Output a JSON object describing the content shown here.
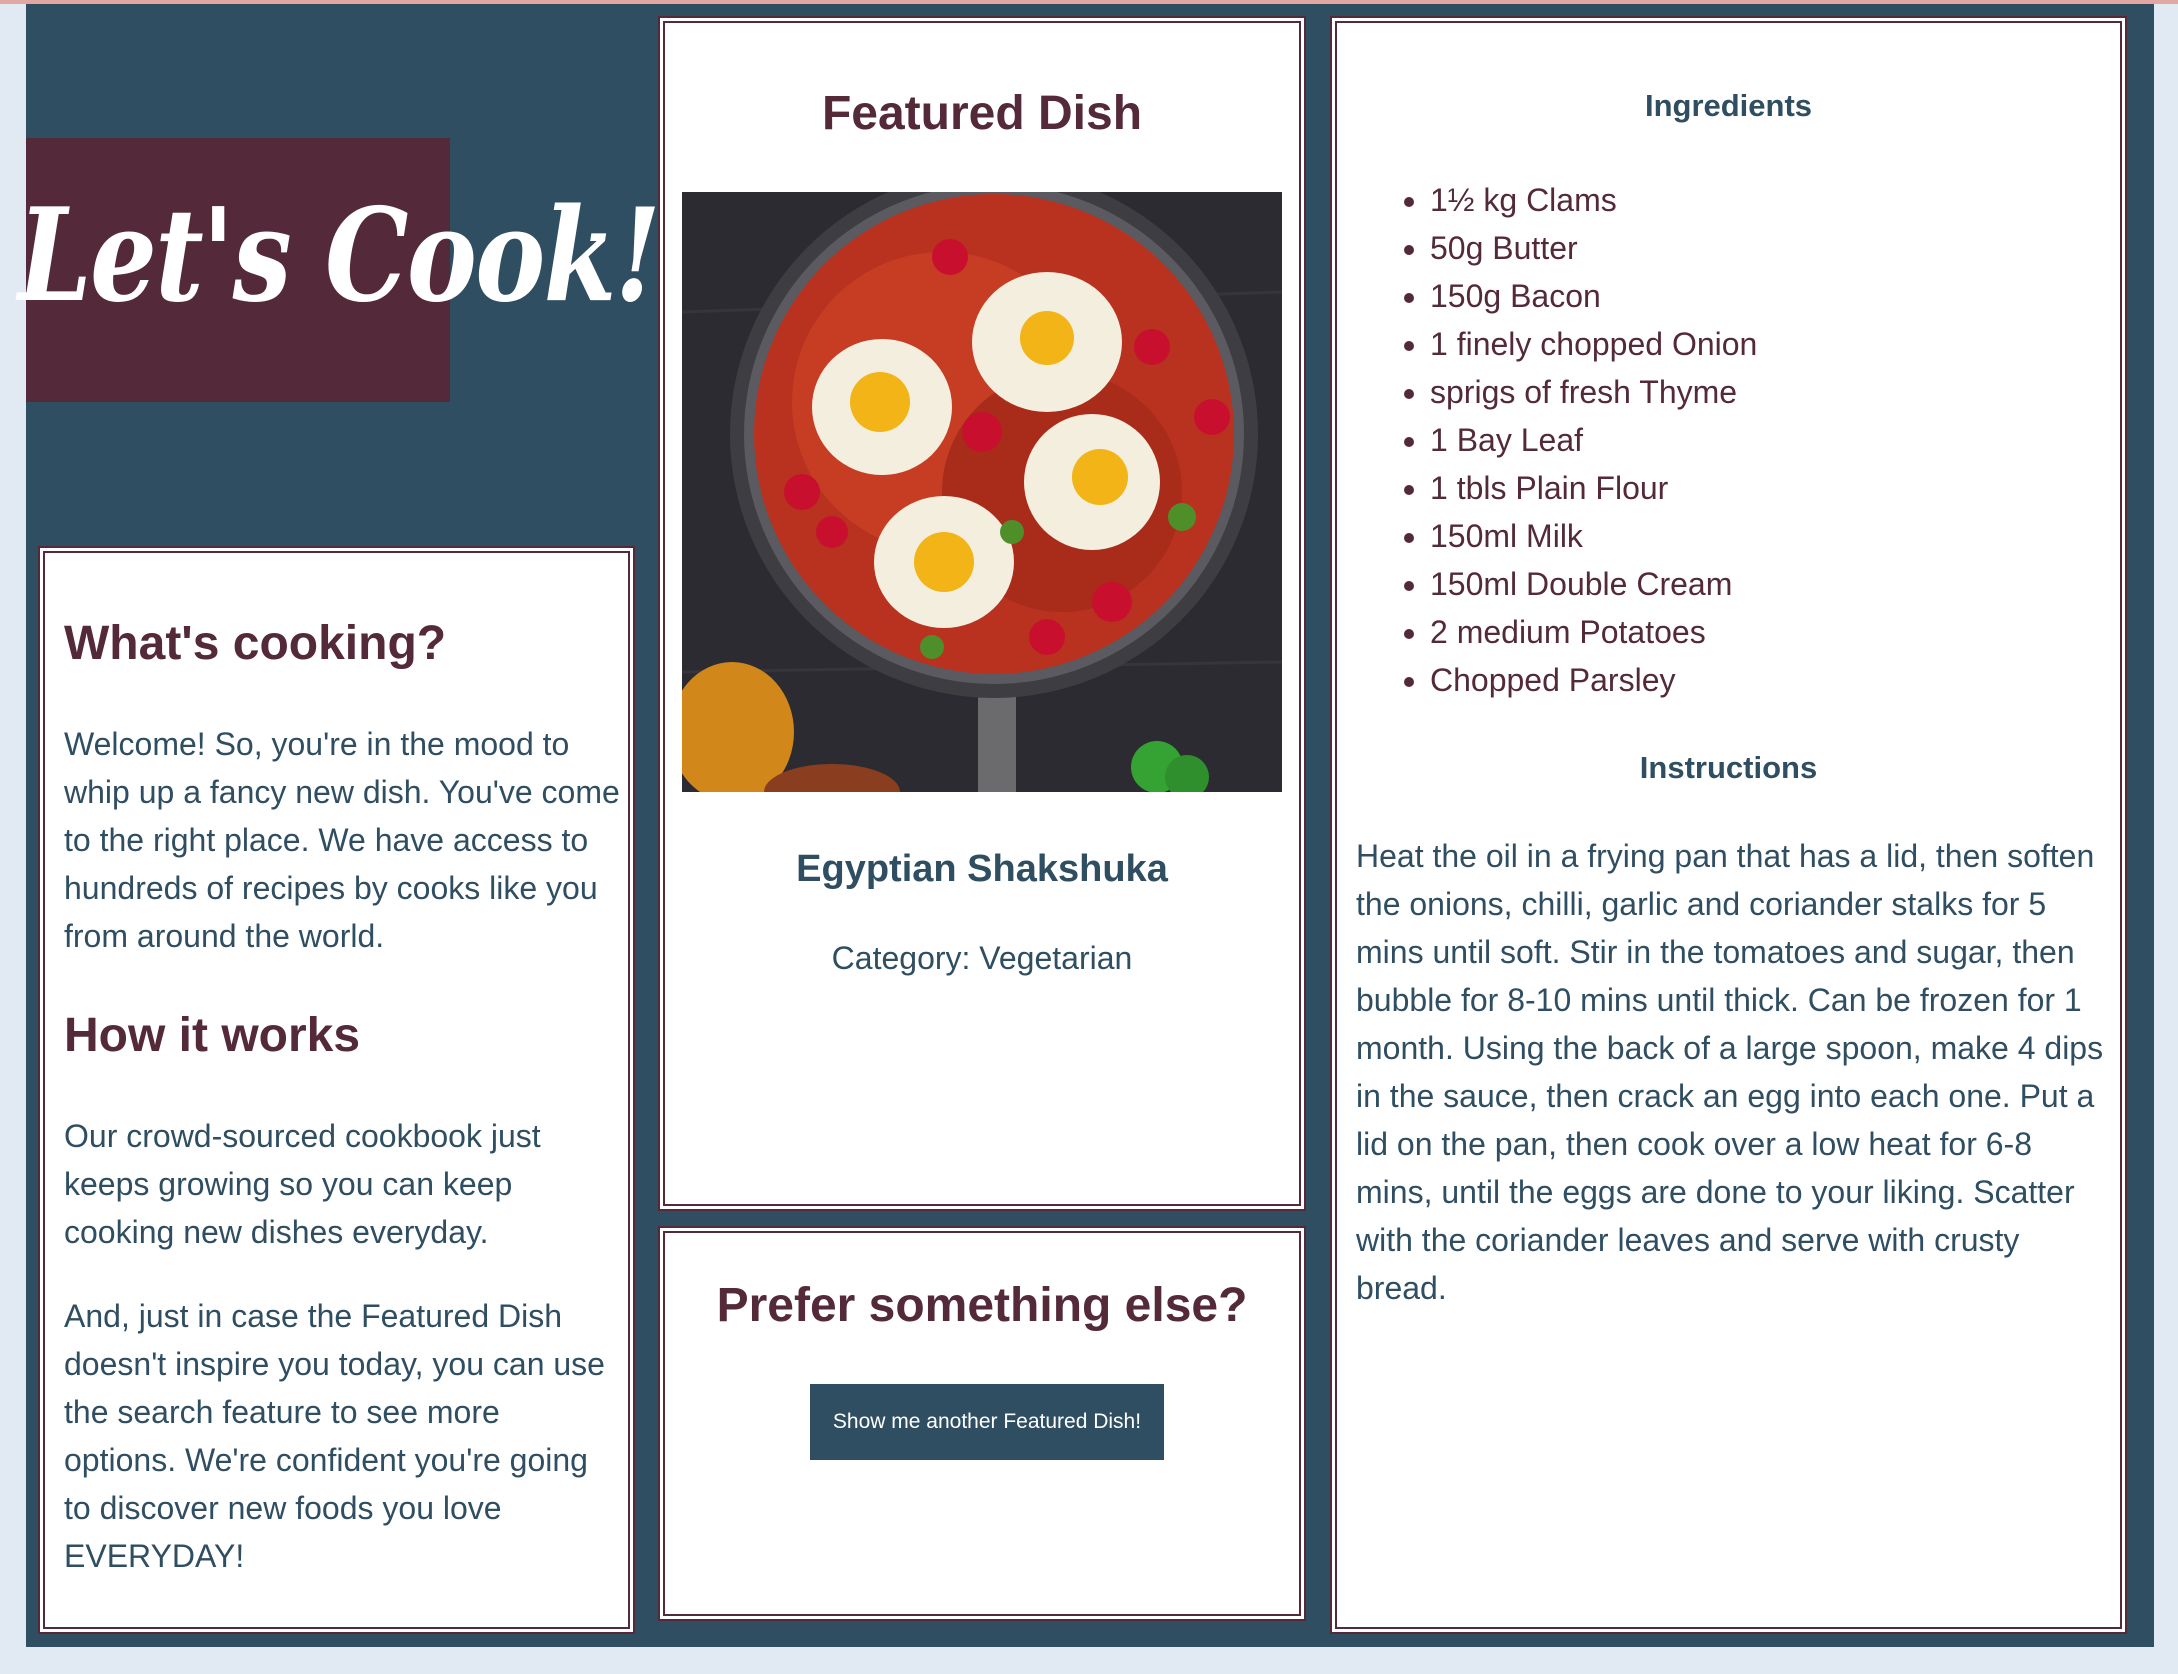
{
  "brand": {
    "logo_text": "Let's Cook!",
    "colors": {
      "navy": "#2f4e62",
      "plum": "#542a3a",
      "background": "#e1e9f3"
    }
  },
  "about": {
    "heading1": "What's cooking?",
    "para1": "Welcome! So, you're in the mood to whip up a fancy new dish. You've come to the right place. We have access to hundreds of recipes by cooks like you from around the world.",
    "heading2": "How it works",
    "para2": "Our crowd-sourced cookbook just keeps growing so you can keep cooking new dishes everyday.",
    "para3": "And, just in case the Featured Dish doesn't inspire you today, you can use the search feature to see more options. We're confident you're going to discover new foods you love EVERYDAY!"
  },
  "featured": {
    "title": "Featured Dish",
    "dish_name": "Egyptian Shakshuka",
    "category": "Category: Vegetarian"
  },
  "prefer": {
    "title": "Prefer something else?",
    "button_label": "Show me another Featured Dish!"
  },
  "recipe": {
    "ingredients_heading": "Ingredients",
    "ingredients": [
      "1½ kg Clams",
      "50g Butter",
      "150g Bacon",
      "1 finely chopped Onion",
      "sprigs of fresh Thyme",
      "1 Bay Leaf",
      "1 tbls Plain Flour",
      "150ml Milk",
      "150ml Double Cream",
      "2 medium Potatoes",
      "Chopped Parsley"
    ],
    "instructions_heading": "Instructions",
    "instructions": "Heat the oil in a frying pan that has a lid, then soften the onions, chilli, garlic and coriander stalks for 5 mins until soft. Stir in the tomatoes and sugar, then bubble for 8-10 mins until thick. Can be frozen for 1 month. Using the back of a large spoon, make 4 dips in the sauce, then crack an egg into each one. Put a lid on the pan, then cook over a low heat for 6-8 mins, until the eggs are done to your liking. Scatter with the coriander leaves and serve with crusty bread."
  }
}
